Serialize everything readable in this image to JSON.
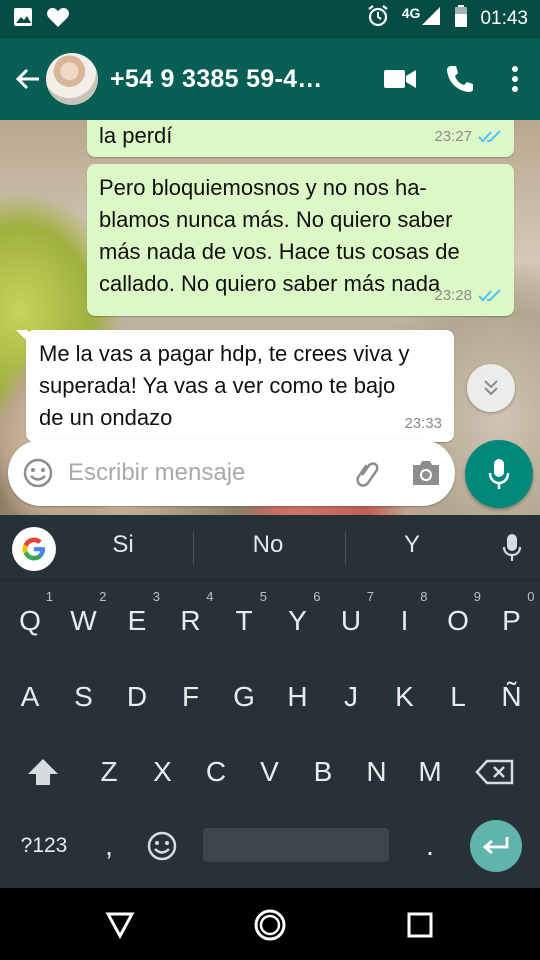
{
  "status_bar": {
    "network": "4G",
    "time": "01:43",
    "icons": [
      "image-icon",
      "heart-icon",
      "alarm-icon",
      "signal-icon",
      "battery-icon"
    ]
  },
  "header": {
    "contact_name": "+54 9 3385 59-4…",
    "icons": [
      "back-arrow-icon",
      "video-call-icon",
      "phone-icon",
      "more-vert-icon"
    ]
  },
  "messages": [
    {
      "direction": "out",
      "text": "la perdí",
      "time": "23:27",
      "status": "read"
    },
    {
      "direction": "out",
      "text": "Pero bloquiemosnos y no nos ha-\nblamos nunca más. No quiero saber\nmás nada de vos. Hace tus cosas de\ncallado. No quiero saber más nada",
      "time": "23:28",
      "status": "read"
    },
    {
      "direction": "in",
      "text": "Me la vas a pagar hdp, te crees viva y\nsuperada! Ya vas a ver como te bajo\nde un ondazo",
      "time": "23:33"
    }
  ],
  "compose": {
    "placeholder": "Escribir mensaje"
  },
  "keyboard": {
    "suggestions": [
      "Si",
      "No",
      "Y"
    ],
    "row1": [
      {
        "key": "Q",
        "hint": "1"
      },
      {
        "key": "W",
        "hint": "2"
      },
      {
        "key": "E",
        "hint": "3"
      },
      {
        "key": "R",
        "hint": "4"
      },
      {
        "key": "T",
        "hint": "5"
      },
      {
        "key": "Y",
        "hint": "6"
      },
      {
        "key": "U",
        "hint": "7"
      },
      {
        "key": "I",
        "hint": "8"
      },
      {
        "key": "O",
        "hint": "9"
      },
      {
        "key": "P",
        "hint": "0"
      }
    ],
    "row2": [
      "A",
      "S",
      "D",
      "F",
      "G",
      "H",
      "J",
      "K",
      "L",
      "Ñ"
    ],
    "row3": [
      "Z",
      "X",
      "C",
      "V",
      "B",
      "N",
      "M"
    ],
    "symbols_key": "?123",
    "comma_key": ",",
    "period_key": "."
  },
  "colors": {
    "header": "#075e54",
    "status_bar": "#054d44",
    "outgoing_bubble": "#dcf8c6",
    "incoming_bubble": "#ffffff",
    "read_ticks": "#4fc3f7",
    "mic_button": "#00897b",
    "keyboard_bg": "#263238",
    "enter_key": "#5fb5ac"
  }
}
